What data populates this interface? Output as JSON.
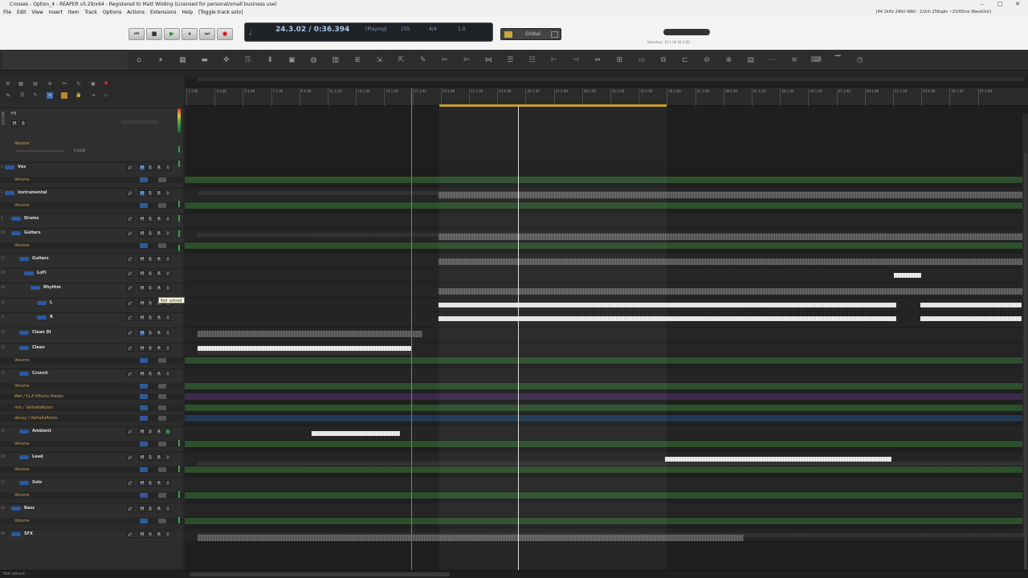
{
  "window": {
    "title": "Crosses - Option_4 - REAPER v5.29/x64 - Registered to Matt Wilding (Licensed for personal/small business use)",
    "status_info": "[44.1kHz 24bit WAV : 2/2ch 256spls ~25/65ms WaveOut]",
    "minimize": "–",
    "maximize": "□",
    "close": "✕"
  },
  "menu": [
    "File",
    "Edit",
    "View",
    "Insert",
    "Item",
    "Track",
    "Options",
    "Actions",
    "Extensions",
    "Help",
    "[Toggle track solo]"
  ],
  "transport": {
    "position": "24.3.02 / 0:36.394",
    "state": "[Playing]",
    "bpm": "155",
    "time_signature": "4/4",
    "rate": "1.0",
    "global_label": "Global",
    "buttons": [
      {
        "name": "skip-start",
        "glyph": "⏮"
      },
      {
        "name": "stop",
        "glyph": "■"
      },
      {
        "name": "play",
        "glyph": "▶"
      },
      {
        "name": "pause",
        "glyph": "⏸"
      },
      {
        "name": "skip-end",
        "glyph": "⏭"
      },
      {
        "name": "record",
        "glyph": "●"
      }
    ]
  },
  "master": {
    "label": "MASTER",
    "fx": "FX",
    "volume_label": "Volume",
    "vol_value": "0.00dB"
  },
  "tracks": [
    {
      "num": "1",
      "name": "Vox",
      "lane": "dark"
    },
    {
      "num": "",
      "name": "Volume",
      "auto": true
    },
    {
      "num": "7",
      "name": "Instrumental"
    },
    {
      "num": "",
      "name": "Volume",
      "auto": true
    },
    {
      "num": "8",
      "name": "Drums"
    },
    {
      "num": "26",
      "name": "Guitars"
    },
    {
      "num": "",
      "name": "Volume",
      "auto": true
    },
    {
      "num": "27",
      "name": "Guitars"
    },
    {
      "num": "28",
      "name": "LoFi"
    },
    {
      "num": "29",
      "name": "Rhythm"
    },
    {
      "num": "30",
      "name": "L"
    },
    {
      "num": "31",
      "name": "R"
    },
    {
      "num": "32",
      "name": "Clean DI"
    },
    {
      "num": "33",
      "name": "Clean"
    },
    {
      "num": "",
      "name": "Volume",
      "auto": true
    },
    {
      "num": "34",
      "name": "Crunch"
    },
    {
      "num": "",
      "name": "Volume",
      "auto": true
    },
    {
      "num": "",
      "name": "Wet / CLA Effects Stereo",
      "auto": true
    },
    {
      "num": "",
      "name": "mix / ValhallaRoom",
      "auto": true
    },
    {
      "num": "",
      "name": "decay / ValhallaRoom",
      "auto": true
    },
    {
      "num": "35",
      "name": "Ambient"
    },
    {
      "num": "",
      "name": "Volume",
      "auto": true
    },
    {
      "num": "36",
      "name": "Lead"
    },
    {
      "num": "",
      "name": "Volume",
      "auto": true
    },
    {
      "num": "37",
      "name": "Solo"
    },
    {
      "num": "",
      "name": "Volume",
      "auto": true
    },
    {
      "num": "40",
      "name": "Bass"
    },
    {
      "num": "",
      "name": "Volume",
      "auto": true
    },
    {
      "num": "46",
      "name": "SFX"
    }
  ],
  "ruler": [
    "1.1.00",
    "3.1.00",
    "5.1.00",
    "7.1.00",
    "9.1.00",
    "11.1.00",
    "13.1.00",
    "15.1.00",
    "17.1.00",
    "19.1.00",
    "21.1.00",
    "23.1.00",
    "25.1.00",
    "27.1.00",
    "29.1.00",
    "31.1.00",
    "33.1.00",
    "35.1.00",
    "37.1.00",
    "39.1.00",
    "41.1.00",
    "43.1.00",
    "45.1.00",
    "47.1.00",
    "49.1.00",
    "51.1.00",
    "53.1.00",
    "55.1.00",
    "57.1.00"
  ],
  "tooltip": "Not soloed",
  "status": "Not solved",
  "toolbar_icons": [
    "metronome-icon",
    "pause-toggle-icon",
    "grid-icon",
    "folder-icon",
    "cursor-icon",
    "copy-icon",
    "down-icon",
    "image-icon",
    "globe-icon",
    "piano-icon",
    "fx-icon",
    "ripple-icon",
    "ripple2-icon",
    "pencil-icon",
    "cut-icon",
    "scissors-icon",
    "glue-icon",
    "lines-icon",
    "lines2-icon",
    "split-icon",
    "trim-icon",
    "stretch-icon",
    "group-icon",
    "item-icon",
    "stack-icon",
    "marker-icon",
    "zoom-out-icon",
    "zoom-in-icon",
    "window-icon",
    "track-icon",
    "mixer-icon",
    "keyboard-icon",
    "snap-icon",
    "clock-icon"
  ]
}
